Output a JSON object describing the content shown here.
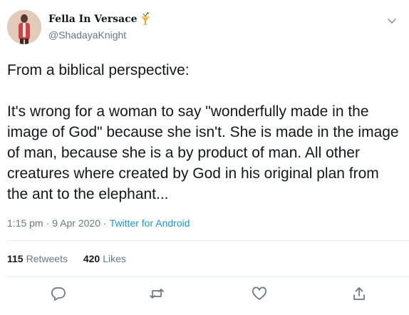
{
  "tweet": {
    "author": {
      "display_name": "Fella In Versace",
      "name_emoji": "tropical-drink-icon",
      "handle": "@ShadayaKnight"
    },
    "text": "From a biblical perspective:\n\nIt's wrong for a woman to say \"wonderfully made in the image of God\" because she isn't. She is made in the image of man, because she is a by product of man. All other creatures where created by God in his original plan from the ant to the elephant...",
    "time": "1:15 pm",
    "date": "9 Apr 2020",
    "separator": "·",
    "source": "Twitter for Android",
    "stats": {
      "retweets_count": "115",
      "retweets_label": "Retweets",
      "likes_count": "420",
      "likes_label": "Likes"
    },
    "actions": [
      "reply-icon",
      "retweet-icon",
      "like-icon",
      "share-icon"
    ]
  },
  "colors": {
    "text": "#14171a",
    "secondary": "#657786",
    "link": "#1b95e0",
    "divider": "#e6ecf0"
  }
}
